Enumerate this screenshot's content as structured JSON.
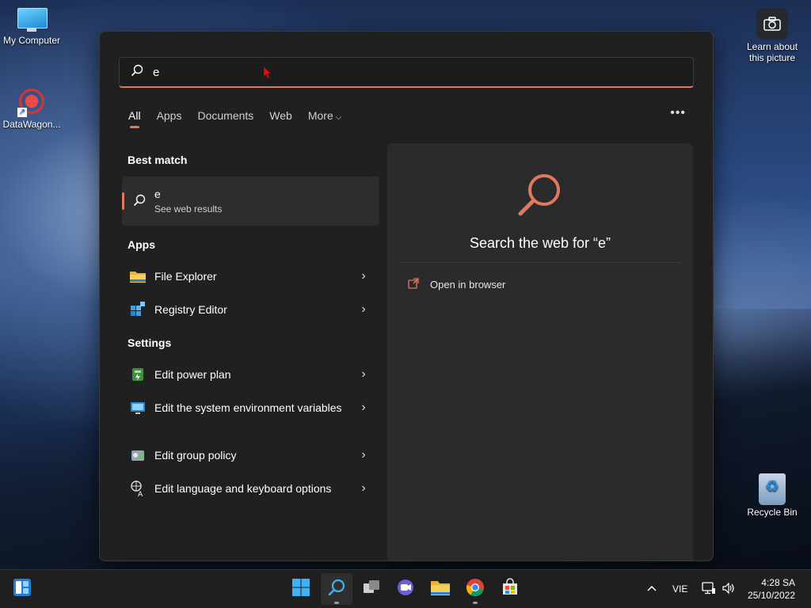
{
  "desktop": {
    "icons": [
      {
        "label": "My Computer"
      },
      {
        "label": "DataWagon..."
      },
      {
        "label": "Learn about this picture"
      },
      {
        "label": "Recycle Bin"
      }
    ]
  },
  "search": {
    "value": "e",
    "tabs": [
      "All",
      "Apps",
      "Documents",
      "Web",
      "More"
    ],
    "active_tab": "All",
    "accent": "#e07a5f"
  },
  "results": {
    "best_match_heading": "Best match",
    "best_match": {
      "title": "e",
      "subtitle": "See web results"
    },
    "apps_heading": "Apps",
    "apps": [
      {
        "label": "File Explorer",
        "icon": "folder-icon"
      },
      {
        "label": "Registry Editor",
        "icon": "registry-icon"
      }
    ],
    "settings_heading": "Settings",
    "settings": [
      {
        "label": "Edit power plan",
        "icon": "power-plan-icon"
      },
      {
        "label": "Edit the system environment variables",
        "icon": "system-env-icon"
      },
      {
        "label": "Edit group policy",
        "icon": "group-policy-icon"
      },
      {
        "label": "Edit language and keyboard options",
        "icon": "language-icon"
      }
    ]
  },
  "preview": {
    "title": "Search the web for “e”",
    "open_in_browser": "Open in browser"
  },
  "taskbar": {
    "apps": [
      "start",
      "search",
      "task-view",
      "chat",
      "file-explorer",
      "chrome",
      "store"
    ],
    "language": "VIE",
    "time": "4:28 SA",
    "date": "25/10/2022"
  }
}
